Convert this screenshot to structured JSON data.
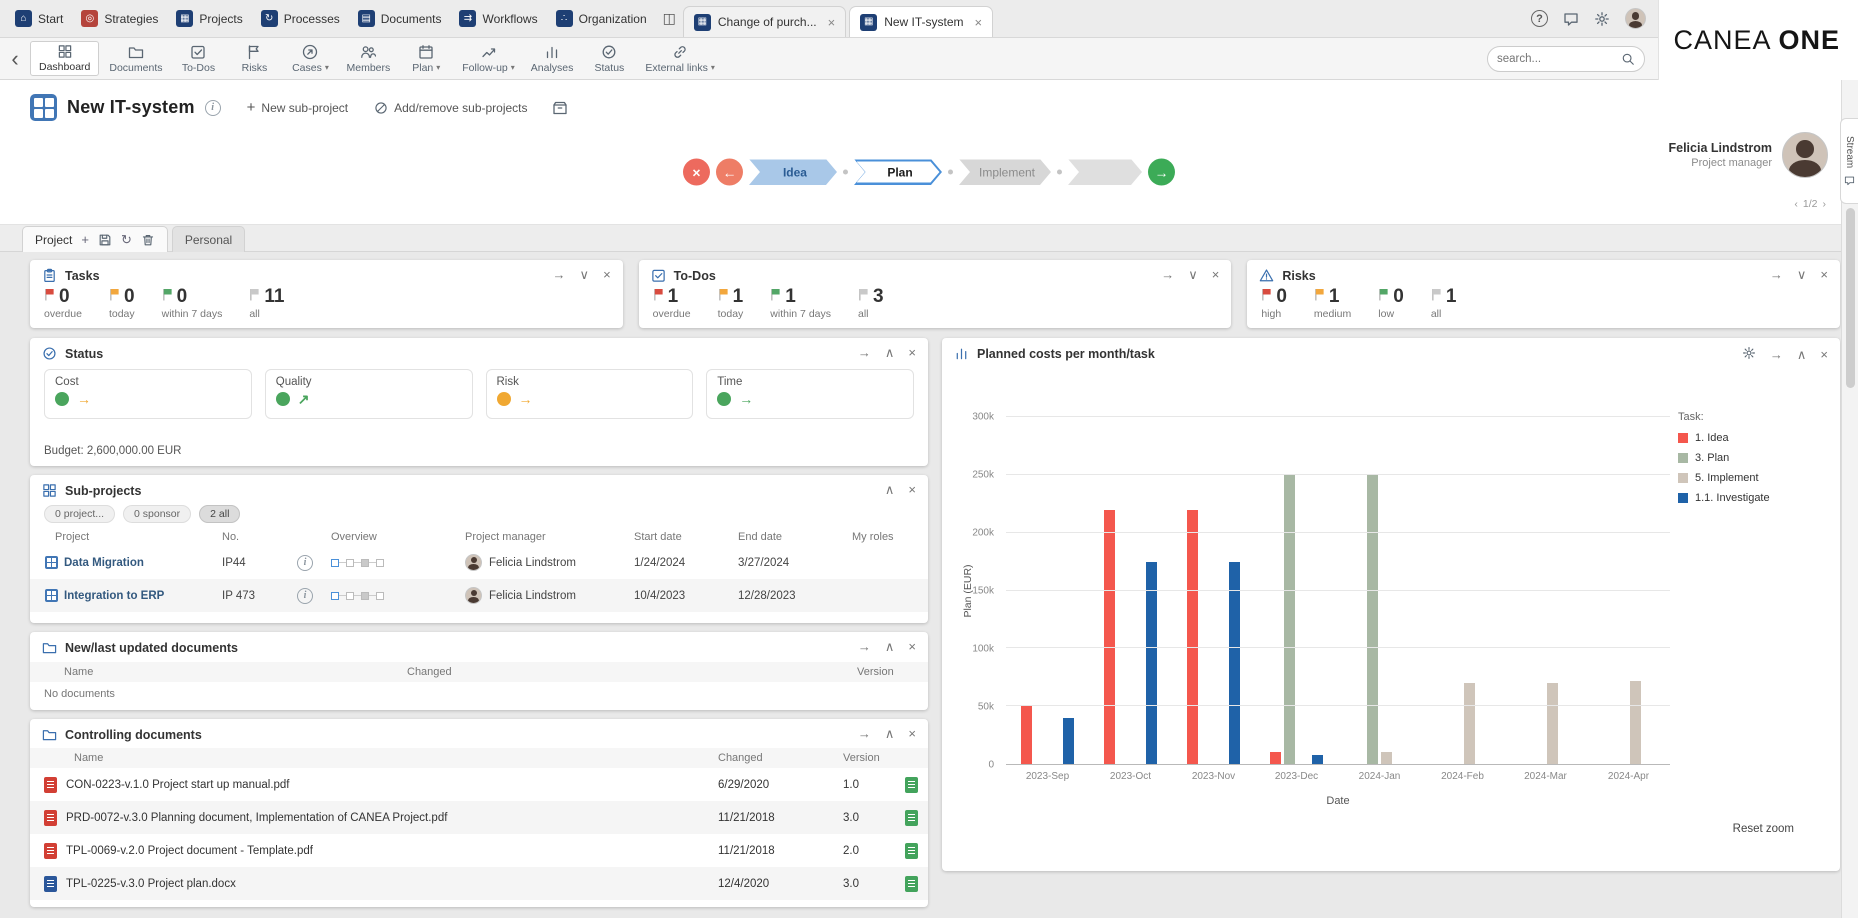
{
  "theme": {
    "navy": "#1e3f74",
    "red-module": "#b5443c",
    "accent": "#4176b5",
    "chev-blue": "#4a90d9",
    "flag-red": "#d84b3f",
    "flag-orange": "#f2a73d",
    "flag-green": "#53a667",
    "flag-gray": "#c9c9c9",
    "dot-green": "#4aa55d",
    "dot-amber": "#f0a832",
    "teal": "#2f9e83",
    "pdf-red": "#d23f34",
    "word-blue": "#2b579a",
    "doc-green": "#43a35c"
  },
  "icons": {
    "popout": "→",
    "collapse": "∧",
    "expand": "∨",
    "close": "×",
    "caret": "▾",
    "plus": "+",
    "refresh": "↻",
    "back": "‹",
    "info": "i",
    "help": "?",
    "pager_prev": "‹",
    "pager_next": "›",
    "flow_cross": "×",
    "flow_back": "←",
    "flow_forward": "→",
    "window": "◫"
  },
  "tab_bar": {
    "modules": [
      {
        "label": "Start",
        "glyph": "⌂"
      },
      {
        "label": "Strategies",
        "glyph": "◎"
      },
      {
        "label": "Projects",
        "glyph": "▦"
      },
      {
        "label": "Processes",
        "glyph": "↻"
      },
      {
        "label": "Documents",
        "glyph": "▤"
      },
      {
        "label": "Workflows",
        "glyph": "⇉"
      },
      {
        "label": "Organization",
        "glyph": "∴"
      }
    ],
    "doc_tabs": [
      {
        "label": "Change of purch...",
        "glyph": "▦"
      },
      {
        "label": "New IT-system",
        "glyph": "▦"
      }
    ],
    "logo_1": "CANEA",
    "logo_2": "ONE"
  },
  "toolbar": {
    "items": [
      {
        "label": "Dashboard",
        "active": true
      },
      {
        "label": "Documents"
      },
      {
        "label": "To-Dos"
      },
      {
        "label": "Risks"
      },
      {
        "label": "Cases",
        "caret": true
      },
      {
        "label": "Members"
      },
      {
        "label": "Plan",
        "caret": true
      },
      {
        "label": "Follow-up",
        "caret": true
      },
      {
        "label": "Analyses"
      },
      {
        "label": "Status"
      },
      {
        "label": "External links",
        "caret": true
      }
    ],
    "search_placeholder": "search..."
  },
  "header": {
    "title": "New IT-system",
    "new_subproject": "New sub-project",
    "add_remove": "Add/remove sub-projects",
    "steps": [
      "Idea",
      "Plan",
      "Implement"
    ],
    "person_name": "Felicia Lindstrom",
    "person_role": "Project manager",
    "pager": "1/2"
  },
  "view_tabs": {
    "project": "Project",
    "personal": "Personal"
  },
  "cards": {
    "tasks": {
      "title": "Tasks",
      "stats": [
        {
          "value": "0",
          "label": "overdue"
        },
        {
          "value": "0",
          "label": "today"
        },
        {
          "value": "0",
          "label": "within 7 days"
        },
        {
          "value": "11",
          "label": "all"
        }
      ]
    },
    "todos": {
      "title": "To-Dos",
      "stats": [
        {
          "value": "1",
          "label": "overdue"
        },
        {
          "value": "1",
          "label": "today"
        },
        {
          "value": "1",
          "label": "within 7 days"
        },
        {
          "value": "3",
          "label": "all"
        }
      ]
    },
    "risks": {
      "title": "Risks",
      "stats": [
        {
          "value": "0",
          "label": "high"
        },
        {
          "value": "1",
          "label": "medium"
        },
        {
          "value": "0",
          "label": "low"
        },
        {
          "value": "1",
          "label": "all"
        }
      ]
    },
    "status": {
      "title": "Status",
      "items": [
        {
          "label": "Cost",
          "trend": "→"
        },
        {
          "label": "Quality",
          "trend": "↗"
        },
        {
          "label": "Risk",
          "trend": "→"
        },
        {
          "label": "Time",
          "trend": "→"
        }
      ],
      "budget": "Budget: 2,600,000.00 EUR"
    },
    "subprojects": {
      "title": "Sub-projects",
      "chips": [
        "0 project...",
        "0 sponsor",
        "2 all"
      ],
      "columns": [
        "Project",
        "No.",
        "",
        "Overview",
        "Project manager",
        "Start date",
        "End date",
        "My roles"
      ],
      "rows": [
        {
          "name": "Data Migration",
          "no": "IP44",
          "manager": "Felicia Lindstrom",
          "start": "1/24/2024",
          "end": "3/27/2024"
        },
        {
          "name": "Integration to ERP",
          "no": "IP 473",
          "manager": "Felicia Lindstrom",
          "start": "10/4/2023",
          "end": "12/28/2023"
        }
      ]
    },
    "new_docs": {
      "title": "New/last updated documents",
      "columns": [
        "Name",
        "Changed",
        "Version"
      ],
      "empty": "No documents"
    },
    "controlling": {
      "title": "Controlling documents",
      "columns": [
        "Name",
        "Changed",
        "Version"
      ],
      "rows": [
        {
          "name": "CON-0223-v.1.0 Project start up manual.pdf",
          "changed": "6/29/2020",
          "version": "1.0",
          "type": "pdf"
        },
        {
          "name": "PRD-0072-v.3.0 Planning document, Implementation of CANEA Project.pdf",
          "changed": "11/21/2018",
          "version": "3.0",
          "type": "pdf"
        },
        {
          "name": "TPL-0069-v.2.0 Project document - Template.pdf",
          "changed": "11/21/2018",
          "version": "2.0",
          "type": "pdf"
        },
        {
          "name": "TPL-0225-v.3.0 Project plan.docx",
          "changed": "12/4/2020",
          "version": "3.0",
          "type": "word"
        }
      ]
    },
    "chart": {
      "reset_label": "Reset zoom"
    }
  },
  "stream": {
    "label": "Stream"
  },
  "chart_data": {
    "type": "bar",
    "title": "Planned costs per month/task",
    "legend_title": "Task:",
    "xlabel": "Date",
    "ylabel": "Plan (EUR)",
    "ylim": [
      0,
      300000
    ],
    "yticks": [
      {
        "value": 0,
        "label": "0"
      },
      {
        "value": 50000,
        "label": "50k"
      },
      {
        "value": 100000,
        "label": "100k"
      },
      {
        "value": 150000,
        "label": "150k"
      },
      {
        "value": 200000,
        "label": "200k"
      },
      {
        "value": 250000,
        "label": "250k"
      },
      {
        "value": 300000,
        "label": "300k"
      }
    ],
    "categories": [
      "2023-Sep",
      "2023-Oct",
      "2023-Nov",
      "2023-Dec",
      "2024-Jan",
      "2024-Feb",
      "2024-Mar",
      "2024-Apr"
    ],
    "series": [
      {
        "name": "1. Idea",
        "color": "#f4574d",
        "values": [
          50000,
          220000,
          220000,
          10000,
          0,
          0,
          0,
          0
        ]
      },
      {
        "name": "3. Plan",
        "color": "#a8b8a4",
        "values": [
          0,
          0,
          0,
          250000,
          250000,
          0,
          0,
          0
        ]
      },
      {
        "name": "5. Implement",
        "color": "#cfc5ba",
        "values": [
          0,
          0,
          0,
          0,
          10000,
          70000,
          70000,
          72000
        ]
      },
      {
        "name": "1.1. Investigate",
        "color": "#1f62a8",
        "values": [
          40000,
          175000,
          175000,
          8000,
          0,
          0,
          0,
          0
        ]
      }
    ],
    "grid": "horizontal",
    "legend_position": "right"
  }
}
